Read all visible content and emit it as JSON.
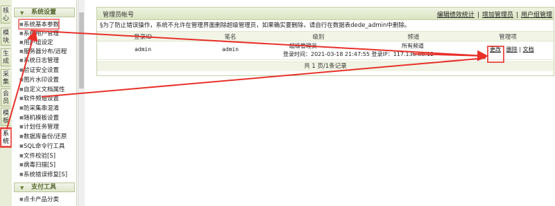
{
  "vertical_tabs": [
    {
      "label": "核心"
    },
    {
      "label": "模块"
    },
    {
      "label": "生成"
    },
    {
      "label": "采集"
    },
    {
      "label": "会员"
    },
    {
      "label": "模板"
    },
    {
      "label": "系统"
    }
  ],
  "menu": {
    "sections": [
      {
        "title": "系统设置",
        "items": [
          "系统基本参数",
          "系统用户管理",
          "用户组设定",
          "服务器分布/远程",
          "系统日志管理",
          "验证安全设置",
          "图片水印设置",
          "自定义文档属性",
          "软件频道设置",
          "防采集串混淆",
          "随机模板设置",
          "计划任务管理",
          "数据库备份/还原",
          "SQL命令行工具",
          "文件校验[S]",
          "病毒扫描[S]",
          "系统错误修复[S]"
        ]
      },
      {
        "title": "支付工具",
        "items": [
          "点卡产品分类"
        ]
      }
    ]
  },
  "panel": {
    "title": "管理员帐号",
    "links": [
      "编辑绩效统计",
      "增加管理员",
      "用户组管理"
    ],
    "link_separator": "|",
    "notice": "§为了防止错误操作，系统不允许在管理界面删除超级管理员，如果确实要删除，请自行在数据表dede_admin中删除。",
    "columns": [
      "登录ID",
      "笔名",
      "级别",
      "频道",
      "管理项"
    ],
    "rows": [
      {
        "login_id": "admin",
        "pen_name": "admin",
        "level": "超级管理员",
        "channel": "所有频道",
        "login_info": "登录时间：2021-03-18 21:47:55  登录IP：117.136.88.12",
        "actions": [
          "更改",
          "删除",
          "文档"
        ]
      }
    ],
    "pager": "共 1 页/1条记录"
  },
  "colors": {
    "annotation_red": "#e8302a",
    "header_green": "#dae4c1"
  }
}
